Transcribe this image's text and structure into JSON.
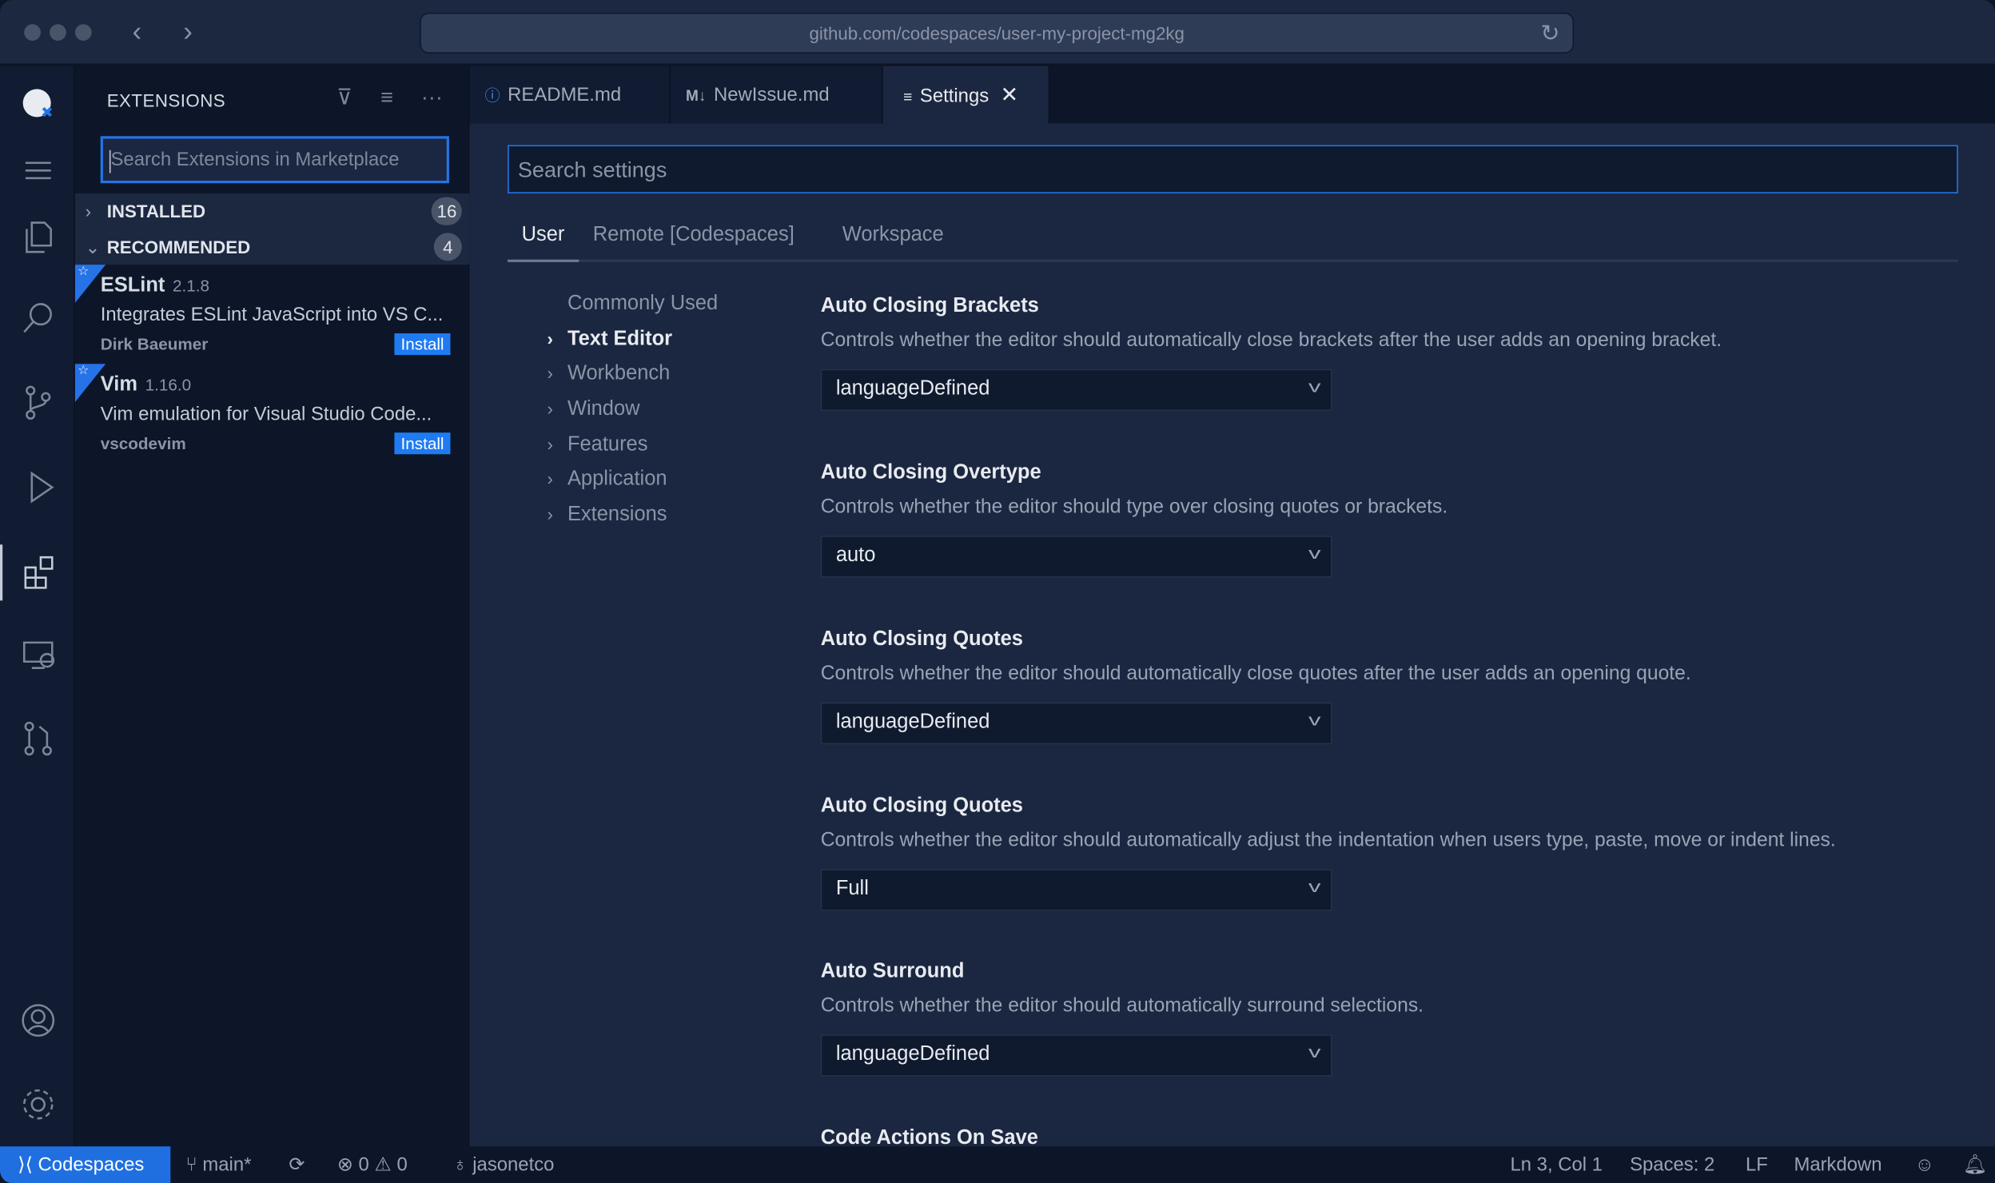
{
  "browser": {
    "url": "github.com/codespaces/user-my-project-mg2kg"
  },
  "sidebar": {
    "title": "EXTENSIONS",
    "search_placeholder": "Search Extensions in Marketplace",
    "sections": [
      {
        "label": "INSTALLED",
        "count": "16",
        "expanded": false
      },
      {
        "label": "RECOMMENDED",
        "count": "4",
        "expanded": true
      }
    ],
    "extensions": [
      {
        "name": "ESLint",
        "version": "2.1.8",
        "description": "Integrates ESLint JavaScript into VS C...",
        "publisher": "Dirk Baeumer",
        "action": "Install"
      },
      {
        "name": "Vim",
        "version": "1.16.0",
        "description": "Vim emulation for Visual Studio Code...",
        "publisher": "vscodevim",
        "action": "Install"
      }
    ]
  },
  "tabs": [
    {
      "label": "README.md",
      "icon": "info-icon"
    },
    {
      "label": "NewIssue.md",
      "icon": "markdown-icon",
      "icon_text": "M↓"
    },
    {
      "label": "Settings",
      "icon": "settings-list-icon",
      "active": true
    }
  ],
  "settings": {
    "search_placeholder": "Search settings",
    "scopes": [
      "User",
      "Remote [Codespaces]",
      "Workspace"
    ],
    "toc": [
      "Commonly Used",
      "Text Editor",
      "Workbench",
      "Window",
      "Features",
      "Application",
      "Extensions"
    ],
    "items": [
      {
        "title": "Auto Closing Brackets",
        "description": "Controls whether the editor should automatically close brackets after the user adds an opening bracket.",
        "value": "languageDefined"
      },
      {
        "title": "Auto Closing Overtype",
        "description": "Controls whether the editor should type over closing quotes or brackets.",
        "value": "auto"
      },
      {
        "title": "Auto Closing Quotes",
        "description": "Controls whether the editor should automatically close quotes after the user adds an opening quote.",
        "value": "languageDefined"
      },
      {
        "title": "Auto Closing Quotes",
        "description": "Controls whether the editor should automatically adjust the indentation when users type, paste, move or indent lines.",
        "value": "Full"
      },
      {
        "title": "Auto Surround",
        "description": "Controls whether the editor should automatically surround selections.",
        "value": "languageDefined"
      },
      {
        "title": "Code Actions On Save"
      }
    ]
  },
  "status": {
    "remote": "Codespaces",
    "branch": "main*",
    "errors": "0",
    "warnings": "0",
    "user": "jasonetco",
    "position": "Ln 3, Col 1",
    "spaces": "Spaces: 2",
    "eol": "LF",
    "language": "Markdown"
  },
  "colors": {
    "accent": "#2673e8",
    "install": "#1f7bf2",
    "status_remote": "#1f6fe0"
  }
}
